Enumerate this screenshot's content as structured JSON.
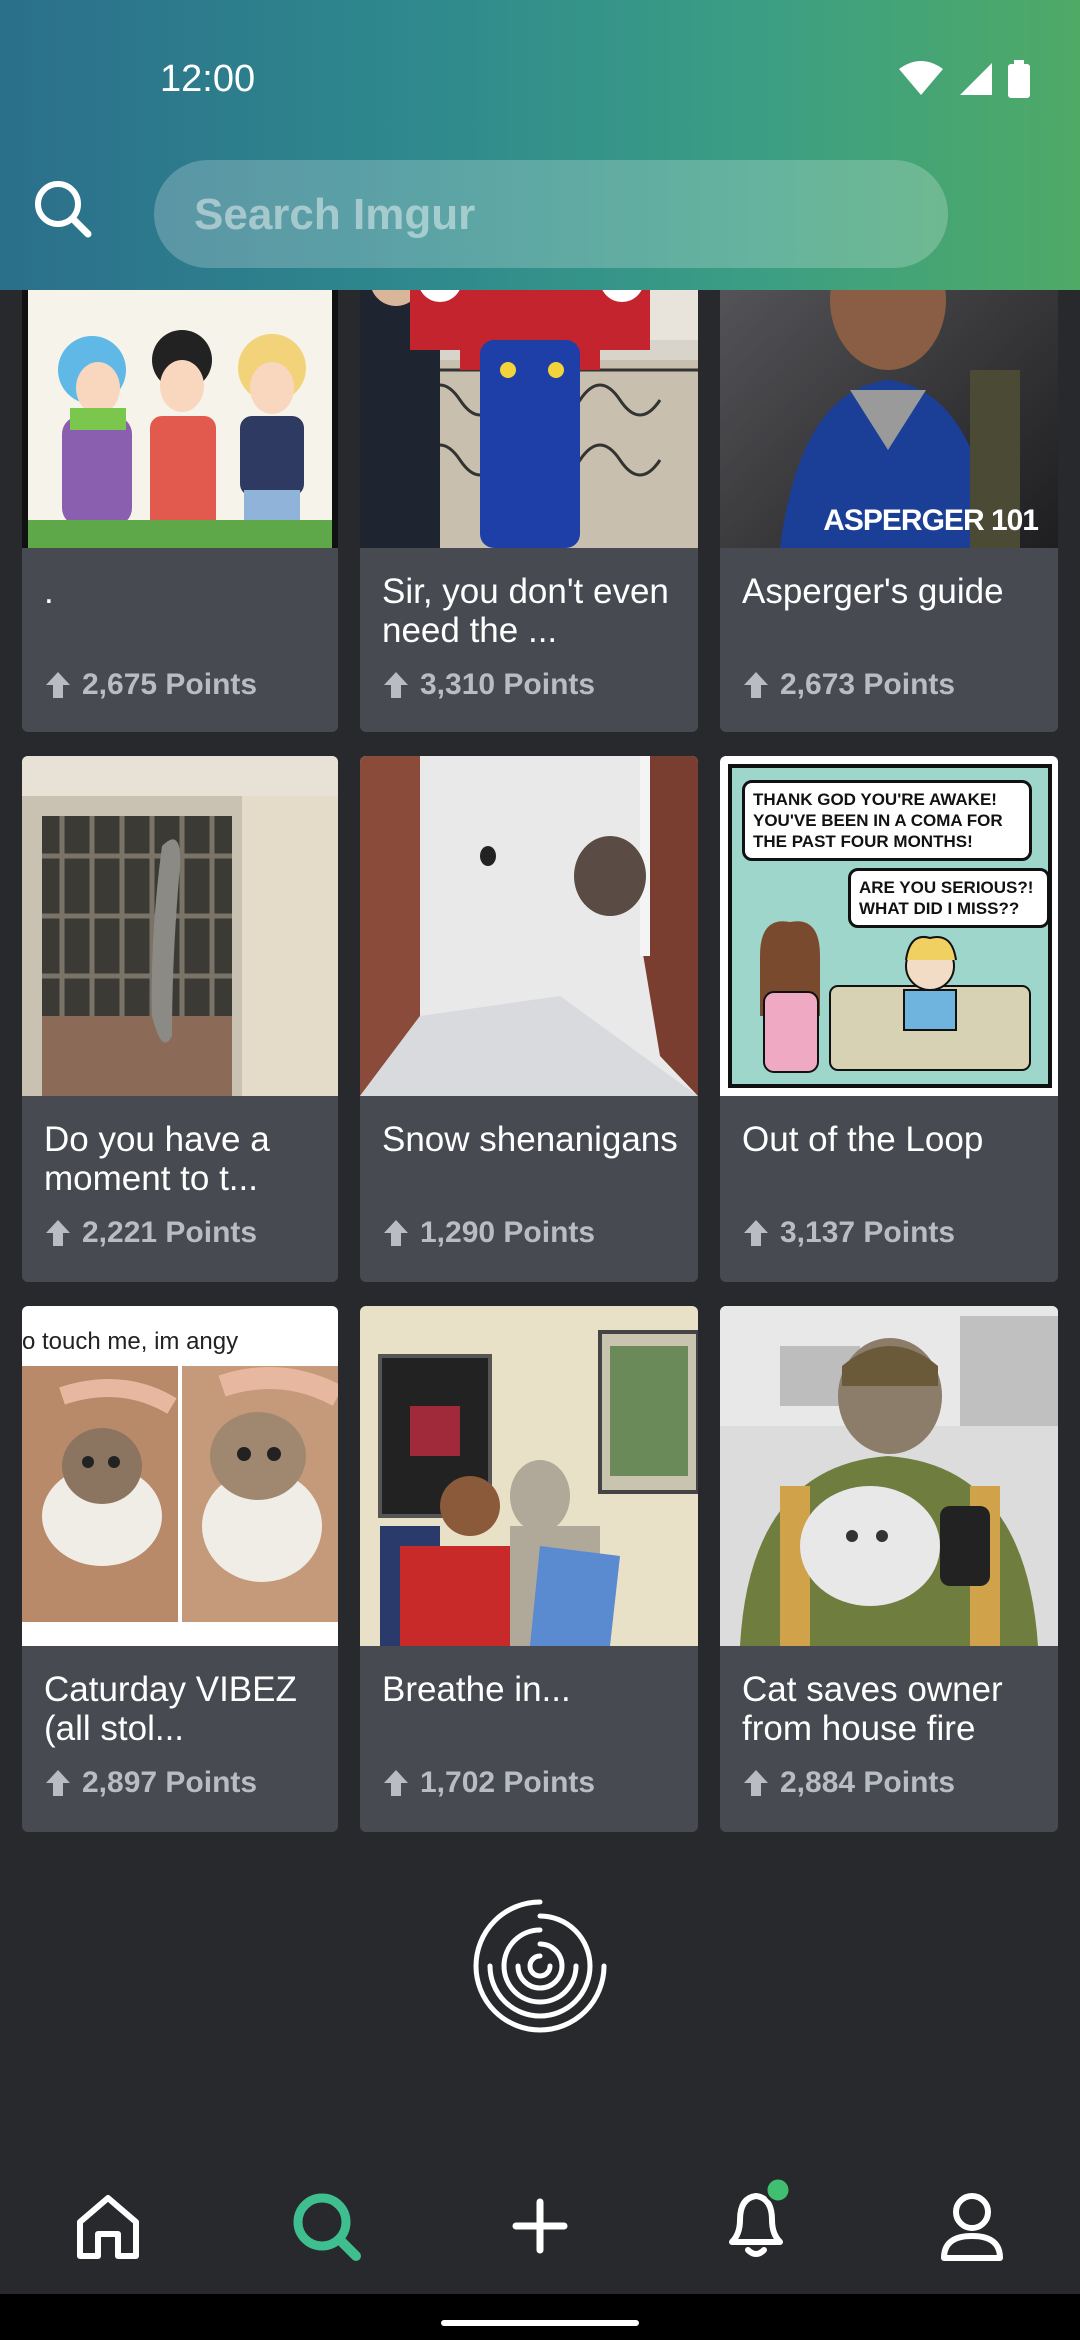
{
  "status": {
    "time": "12:00"
  },
  "search": {
    "placeholder": "Search Imgur"
  },
  "posts": [
    {
      "title": ".",
      "points": "2,675 Points"
    },
    {
      "title": "Sir, you don't even need the ...",
      "points": "3,310 Points"
    },
    {
      "title": "Asperger's guide",
      "points": "2,673 Points",
      "image_caption": "ASPERGER 101"
    },
    {
      "title": "Do you have a moment to t...",
      "points": "2,221 Points"
    },
    {
      "title": "Snow shenanigans",
      "points": "1,290 Points"
    },
    {
      "title": "Out of the Loop",
      "points": "3,137 Points",
      "image_text_1": "THANK GOD YOU'RE AWAKE! YOU'VE BEEN IN A COMA FOR THE PAST FOUR MONTHS!",
      "image_text_2": "ARE YOU SERIOUS?! WHAT DID I MISS??"
    },
    {
      "title": "Caturday VIBEZ (all stol...",
      "points": "2,897 Points",
      "image_caption": "o touch me, im angy"
    },
    {
      "title": "Breathe in...",
      "points": "1,702 Points"
    },
    {
      "title": "Cat saves owner from house fire",
      "points": "2,884 Points"
    }
  ],
  "nav": [
    "home-icon",
    "search-icon",
    "add-icon",
    "notification-icon",
    "profile-icon"
  ],
  "colors": {
    "accent": "#3fbf8f",
    "card": "#474a51",
    "background": "#27292d",
    "notification_dot": "#3fbf6f"
  }
}
